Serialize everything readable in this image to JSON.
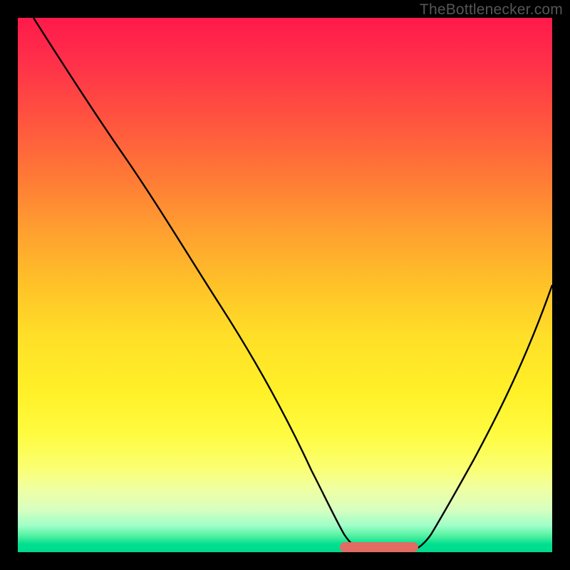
{
  "watermark": "TheBottlenecker.com",
  "colors": {
    "frame": "#000000",
    "curve": "#000000",
    "marker": "#e26b62"
  },
  "chart_data": {
    "type": "line",
    "title": "",
    "xlabel": "",
    "ylabel": "",
    "xlim": [
      0,
      100
    ],
    "ylim": [
      0,
      100
    ],
    "x": [
      3,
      8,
      14,
      20,
      26,
      32,
      38,
      44,
      50,
      55,
      58,
      60,
      63,
      67,
      72,
      75,
      80,
      85,
      90,
      95,
      100
    ],
    "values": [
      100,
      92,
      83,
      74,
      65,
      55,
      46,
      36,
      26,
      15,
      8,
      4,
      1,
      0,
      0,
      2,
      8,
      17,
      27,
      38,
      50
    ],
    "optimal_range_x": [
      60,
      75
    ],
    "annotations": []
  }
}
